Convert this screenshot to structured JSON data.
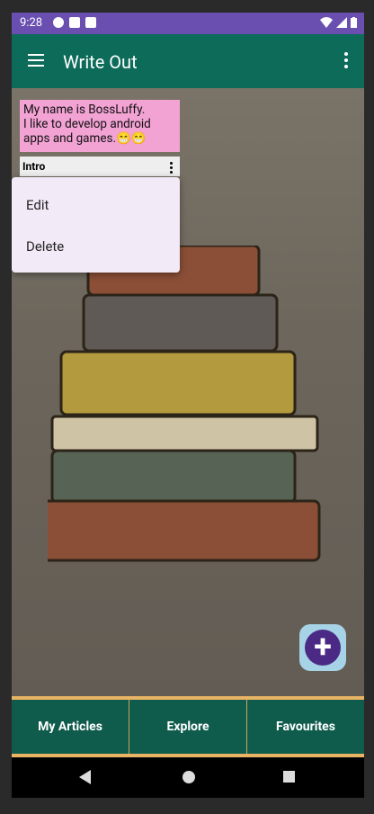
{
  "status_bar": {
    "time": "9:28",
    "icons": [
      "gear-icon",
      "text-icon",
      "sd-card-icon",
      "wifi-icon",
      "signal-icon",
      "battery-icon"
    ]
  },
  "app_bar": {
    "title": "Write Out",
    "menu_icon": "hamburger-menu-icon",
    "more_icon": "more-vertical-icon"
  },
  "article": {
    "body_line1": "My name is BossLuffy.",
    "body_line2": "I like to develop android",
    "body_line3": "apps and games.😁😁",
    "title": "Intro"
  },
  "popup_menu": {
    "items": [
      "Edit",
      "Delete"
    ]
  },
  "fab": {
    "icon": "+"
  },
  "bottom_nav": {
    "tabs": [
      "My Articles",
      "Explore",
      "Favourites"
    ]
  },
  "colors": {
    "status": "#6a4fb0",
    "appbar": "#0d6b59",
    "nav": "#0f5c4d",
    "accent": "#e9b463",
    "card": "#f2a3d4",
    "fab": "#4b2a85"
  }
}
